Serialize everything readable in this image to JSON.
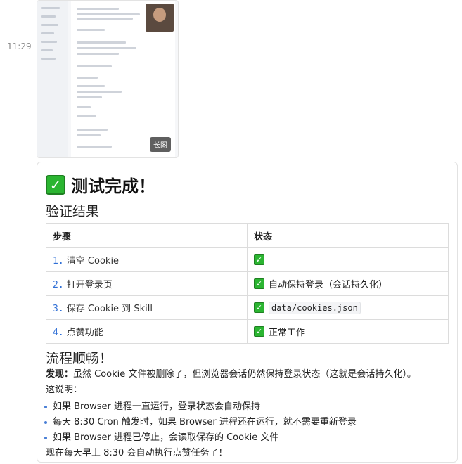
{
  "message": {
    "time": "11:29"
  },
  "thumbnail": {
    "badge": "长图"
  },
  "card": {
    "title_icon": "check-mark-icon",
    "title": "测试完成！",
    "subtitle": "验证结果",
    "table": {
      "headers": [
        "步骤",
        "状态"
      ],
      "rows": [
        {
          "num": "1.",
          "step": "清空 Cookie",
          "status": "",
          "code": ""
        },
        {
          "num": "2.",
          "step": "打开登录页",
          "status": "自动保持登录（会话持久化）",
          "code": ""
        },
        {
          "num": "3.",
          "step": "保存 Cookie 到 Skill",
          "status": "",
          "code": "data/cookies.json"
        },
        {
          "num": "4.",
          "step": "点赞功能",
          "status": "正常工作",
          "code": ""
        }
      ]
    },
    "heading2": "流程顺畅！",
    "finding_label": "发现：",
    "finding_text": "虽然 Cookie 文件被删除了，但浏览器会话仍然保持登录状态（这就是会话持久化）。",
    "explain": "这说明：",
    "bullets": [
      "如果 Browser 进程一直运行，登录状态会自动保持",
      "每天 8:30 Cron 触发时，如果 Browser 进程还在运行，就不需要重新登录",
      "如果 Browser 进程已停止，会读取保存的 Cookie 文件"
    ],
    "closing": "现在每天早上 8:30 会自动执行点赞任务了！"
  },
  "colors": {
    "check_green": "#2bb531",
    "list_blue": "#2f6fd6"
  }
}
